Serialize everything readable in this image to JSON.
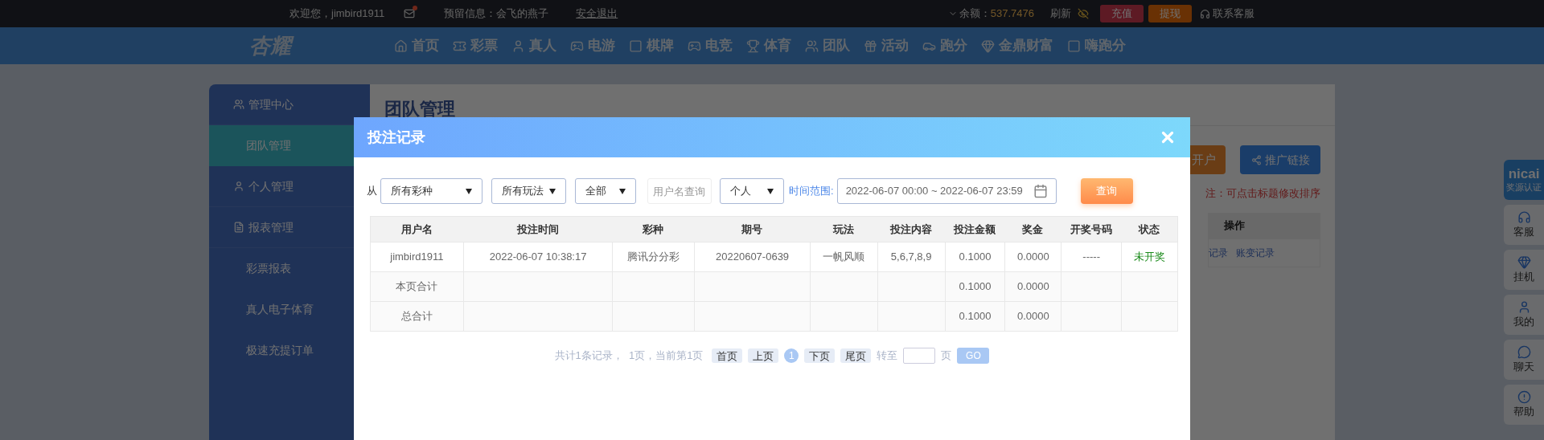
{
  "top_bar": {
    "welcome": "欢迎您，jimbird1911",
    "message": "预留信息：会飞的燕子",
    "logout": "安全退出",
    "balance_label": "余额：",
    "balance": "537.7476",
    "refresh": "刷新",
    "deposit": "充值",
    "withdraw": "提现",
    "support": "联系客服"
  },
  "nav": {
    "logo": "杏耀",
    "items": [
      "首页",
      "彩票",
      "真人",
      "电游",
      "棋牌",
      "电竞",
      "体育",
      "团队",
      "活动",
      "跑分",
      "金鼎财富",
      "嗨跑分"
    ]
  },
  "sidebar": {
    "sections": [
      {
        "label": "管理中心",
        "children": [
          {
            "label": "团队管理",
            "selected": true
          }
        ]
      },
      {
        "label": "个人管理"
      },
      {
        "label": "报表管理",
        "children": [
          {
            "label": "彩票报表",
            "selected": false
          },
          {
            "label": "真人电子体育",
            "selected": false
          },
          {
            "label": "极速充提订单",
            "selected": false
          }
        ]
      }
    ]
  },
  "page": {
    "title": "团队管理",
    "buttons": [
      "开户",
      "推广链接"
    ],
    "note": "注：可点击标题修改排序",
    "table": {
      "column": "操作",
      "links": [
        "记录",
        "账变记录"
      ]
    }
  },
  "side_tools": {
    "badge": {
      "logo": "nicai",
      "label": "奖源认证"
    },
    "items": [
      "客服",
      "挂机",
      "我的",
      "聊天",
      "帮助"
    ]
  },
  "modal": {
    "title": "投注记录",
    "filters": {
      "from_label": "从",
      "lottery": "所有彩种",
      "play": "所有玩法",
      "scope": "全部",
      "username_placeholder": "用户名查询",
      "who": "个人",
      "range_label": "时间范围:",
      "range": "2022-06-07 00:00 ~ 2022-06-07 23:59",
      "search": "查询"
    },
    "table": {
      "columns": [
        "用户名",
        "投注时间",
        "彩种",
        "期号",
        "玩法",
        "投注内容",
        "投注金额",
        "奖金",
        "开奖号码",
        "状态"
      ],
      "rows": [
        {
          "kind": "data",
          "cells": [
            "jimbird1911",
            "2022-06-07 10:38:17",
            "腾讯分分彩",
            "20220607-0639",
            "一帆风顺",
            "5,6,7,8,9",
            "0.1000",
            "0.0000",
            "-----",
            "未开奖"
          ]
        },
        {
          "kind": "summary",
          "label": "本页合计",
          "amount": "0.1000",
          "bonus": "0.0000"
        },
        {
          "kind": "summary",
          "label": "总合计",
          "amount": "0.1000",
          "bonus": "0.0000"
        }
      ]
    },
    "pagination": {
      "summary": "共计1条记录，  1页，当前第1页",
      "first": "首页",
      "prev": "上页",
      "pages": [
        {
          "label": "1",
          "selected": true
        }
      ],
      "next": "下页",
      "last": "尾页",
      "goto_label": "转至",
      "page_unit": "页",
      "go": "GO"
    }
  }
}
